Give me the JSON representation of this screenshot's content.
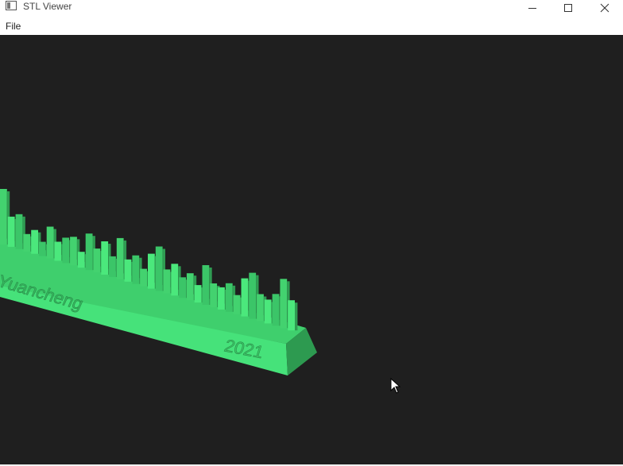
{
  "window": {
    "title": "STL Viewer",
    "controls": {
      "minimize": "minimize-icon",
      "maximize": "maximize-icon",
      "close": "close-icon"
    }
  },
  "menu": {
    "items": [
      "File"
    ]
  },
  "viewport": {
    "background": "#1f1f1f",
    "model": {
      "color_top": "#4be87c",
      "color_front": "#43d26f",
      "color_side": "#2f9c52",
      "embossed_name": "Yuancheng",
      "embossed_year": "2021"
    }
  },
  "colors": {
    "titlebar_bg": "#ffffff",
    "menubar_bg": "#ffffff"
  }
}
